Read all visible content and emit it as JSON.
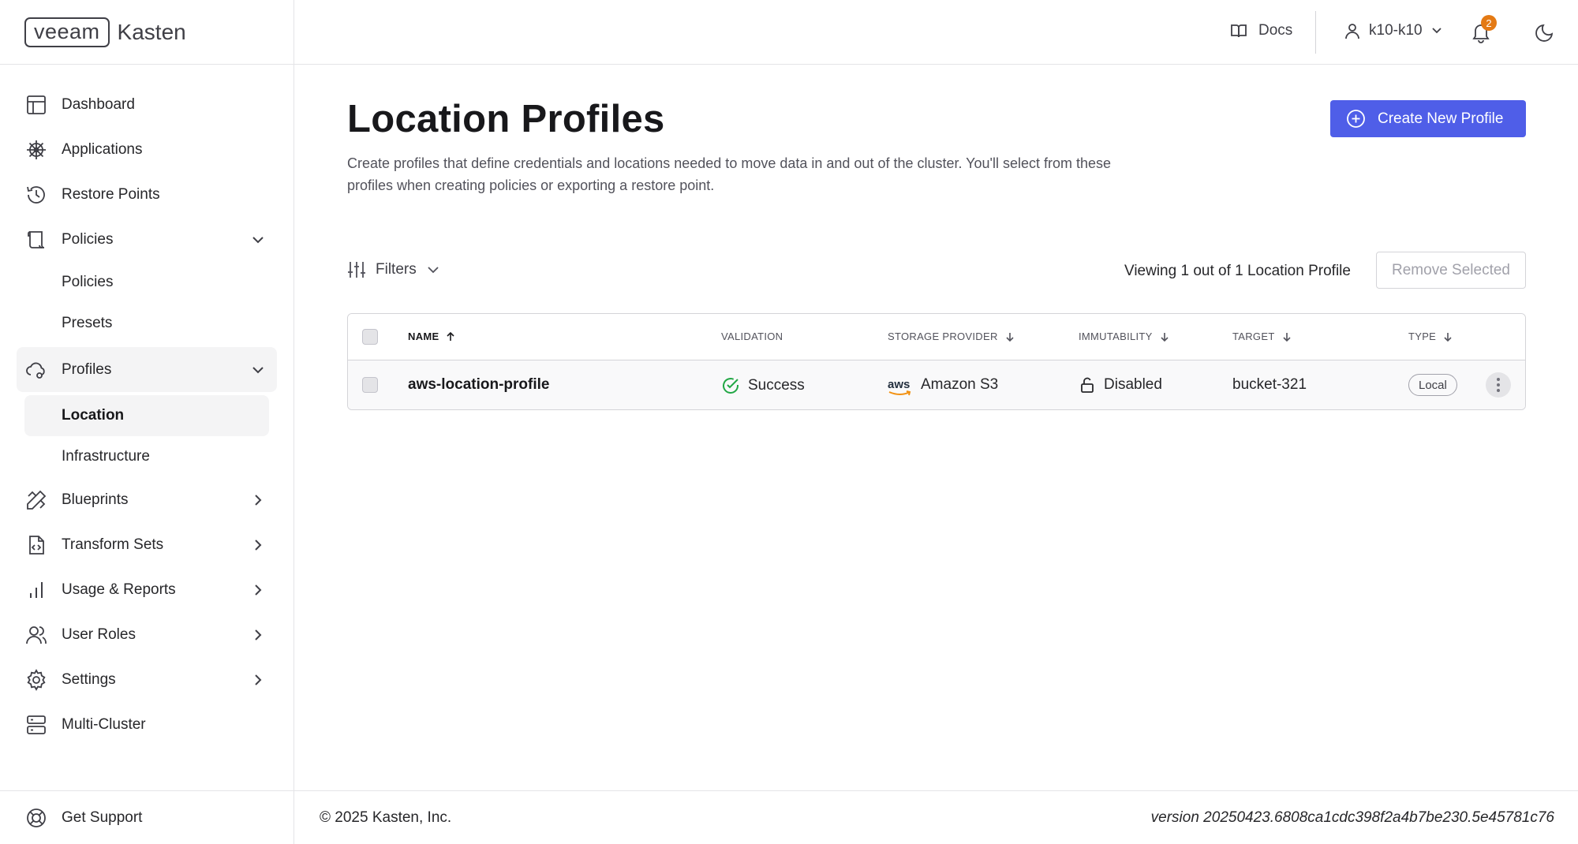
{
  "brand": {
    "logo_part1": "veeam",
    "logo_part2": "Kasten"
  },
  "header": {
    "docs_label": "Docs",
    "user_label": "k10-k10",
    "notification_count": "2"
  },
  "sidebar": {
    "items": [
      {
        "label": "Dashboard",
        "icon": "dashboard-icon"
      },
      {
        "label": "Applications",
        "icon": "helm-icon"
      },
      {
        "label": "Restore Points",
        "icon": "history-icon"
      },
      {
        "label": "Policies",
        "icon": "scroll-icon",
        "expanded": true,
        "children": [
          "Policies",
          "Presets"
        ]
      },
      {
        "label": "Profiles",
        "icon": "cloud-profile-icon",
        "expanded": true,
        "children": [
          "Location",
          "Infrastructure"
        ],
        "selected_child": "Location"
      },
      {
        "label": "Blueprints",
        "icon": "pencil-ruler-icon"
      },
      {
        "label": "Transform Sets",
        "icon": "file-code-icon"
      },
      {
        "label": "Usage & Reports",
        "icon": "bar-chart-icon"
      },
      {
        "label": "User Roles",
        "icon": "users-icon"
      },
      {
        "label": "Settings",
        "icon": "gear-icon"
      },
      {
        "label": "Multi-Cluster",
        "icon": "server-icon"
      }
    ],
    "support_label": "Get Support"
  },
  "main": {
    "title": "Location Profiles",
    "description": "Create profiles that define credentials and locations needed to move data in and out of the cluster. You'll select from these profiles when creating policies or exporting a restore point.",
    "create_button": "Create New Profile",
    "filters_label": "Filters",
    "viewing_text": "Viewing 1 out of 1 Location Profile",
    "remove_button": "Remove Selected",
    "table": {
      "columns": [
        "NAME",
        "VALIDATION",
        "STORAGE PROVIDER",
        "IMMUTABILITY",
        "TARGET",
        "TYPE"
      ],
      "rows": [
        {
          "name": "aws-location-profile",
          "validation": "Success",
          "provider_logo": "aws",
          "provider": "Amazon S3",
          "immutability": "Disabled",
          "target": "bucket-321",
          "type": "Local"
        }
      ]
    }
  },
  "footer": {
    "copyright": "© 2025 Kasten, Inc.",
    "version": "version 20250423.6808ca1cdc398f2a4b7be230.5e45781c76"
  },
  "colors": {
    "primary": "#4f5ee8",
    "success": "#22a745",
    "badge": "#e47a14",
    "aws_orange": "#f29111"
  }
}
